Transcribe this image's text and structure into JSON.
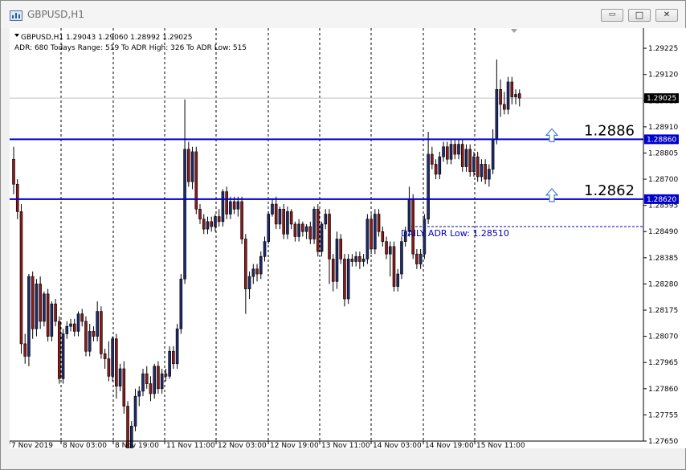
{
  "window": {
    "title": "GBPUSD,H1",
    "buttons": {
      "minimize": "▭",
      "restore": "□",
      "close": "✕"
    }
  },
  "header": {
    "symbol_line": "GBPUSD,H1  1.29043 1.29060 1.28992 1.29025",
    "adr_line": "ADR: 680  Todays Range: 519  To ADR High: 326  To ADR Low: 515"
  },
  "colors": {
    "background": "#ffffff",
    "bear_candle": "#8b1a1a",
    "bull_candle": "#1f2a6b",
    "level_line": "#0000cc",
    "level_tag": "#0000cc",
    "price_tag": "#000000",
    "arrow": "#4a7fd0",
    "grid_line": "#000000",
    "adr_line": "#0000aa",
    "current_price_line": "#c0c0c0"
  },
  "chart_data": {
    "type": "candlestick",
    "symbol": "GBPUSD",
    "timeframe": "H1",
    "y_axis": {
      "range": [
        1.2765,
        1.2928
      ],
      "ticks": [
        "1.29225",
        "1.29120",
        "1.29015",
        "1.28910",
        "1.28805",
        "1.28700",
        "1.28595",
        "1.28490",
        "1.28385",
        "1.28280",
        "1.28175",
        "1.28070",
        "1.27965",
        "1.27860",
        "1.27755",
        "1.27650"
      ]
    },
    "x_axis": {
      "labels": [
        "7 Nov 2019",
        "8 Nov 03:00",
        "8 Nov 19:00",
        "11 Nov 11:00",
        "12 Nov 03:00",
        "12 Nov 19:00",
        "13 Nov 11:00",
        "14 Nov 03:00",
        "14 Nov 19:00",
        "15 Nov 11:00"
      ]
    },
    "current_price": {
      "value": 1.29025,
      "label": "1.29025"
    },
    "levels": [
      {
        "name": "1.2886",
        "value": 1.2886,
        "axis_label": "1.28860",
        "big_label": "1.2886"
      },
      {
        "name": "1.2862",
        "value": 1.2862,
        "axis_label": "1.28620",
        "big_label": "1.2862"
      }
    ],
    "adr_low": {
      "value": 1.2851,
      "label": "DAILY ADR Low: 1.28510"
    },
    "candles": [
      [
        1.2878,
        1.2868,
        1.2883,
        1.2864
      ],
      [
        1.2868,
        1.2857,
        1.287,
        1.2854
      ],
      [
        1.2857,
        1.2804,
        1.286,
        1.28
      ],
      [
        1.2804,
        1.2799,
        1.2808,
        1.2796
      ],
      [
        1.2799,
        1.2831,
        1.2832,
        1.2795
      ],
      [
        1.2831,
        1.281,
        1.2833,
        1.2806
      ],
      [
        1.281,
        1.2828,
        1.283,
        1.2807
      ],
      [
        1.2828,
        1.2813,
        1.2831,
        1.281
      ],
      [
        1.2813,
        1.2824,
        1.2825,
        1.2811
      ],
      [
        1.2824,
        1.2807,
        1.2826,
        1.2805
      ],
      [
        1.2807,
        1.282,
        1.2821,
        1.2805
      ],
      [
        1.282,
        1.2813,
        1.2822,
        1.2811
      ],
      [
        1.2813,
        1.279,
        1.2815,
        1.2788
      ],
      [
        1.279,
        1.2808,
        1.281,
        1.2788
      ],
      [
        1.2808,
        1.2811,
        1.2813,
        1.2806
      ],
      [
        1.2811,
        1.2812,
        1.2814,
        1.2809
      ],
      [
        1.2812,
        1.2809,
        1.2814,
        1.2807
      ],
      [
        1.2809,
        1.2816,
        1.2817,
        1.2807
      ],
      [
        1.2816,
        1.2813,
        1.2818,
        1.2811
      ],
      [
        1.2813,
        1.2801,
        1.2815,
        1.2799
      ],
      [
        1.2801,
        1.2809,
        1.2812,
        1.2799
      ],
      [
        1.2809,
        1.2807,
        1.2811,
        1.2805
      ],
      [
        1.2807,
        1.2817,
        1.2821,
        1.2805
      ],
      [
        1.2817,
        1.28,
        1.2819,
        1.2798
      ],
      [
        1.28,
        1.2798,
        1.2802,
        1.2794
      ],
      [
        1.2798,
        1.2791,
        1.2805,
        1.2789
      ],
      [
        1.2791,
        1.2806,
        1.2807,
        1.2789
      ],
      [
        1.2806,
        1.2787,
        1.2808,
        1.2782
      ],
      [
        1.2787,
        1.2794,
        1.2796,
        1.2785
      ],
      [
        1.2794,
        1.2779,
        1.2797,
        1.2776
      ],
      [
        1.2779,
        1.2761,
        1.2781,
        1.2759
      ],
      [
        1.2761,
        1.2771,
        1.2773,
        1.2759
      ],
      [
        1.2771,
        1.2783,
        1.2786,
        1.2769
      ],
      [
        1.2783,
        1.2785,
        1.2787,
        1.2779
      ],
      [
        1.2785,
        1.2792,
        1.2794,
        1.2783
      ],
      [
        1.2792,
        1.2788,
        1.2795,
        1.2786
      ],
      [
        1.2788,
        1.2784,
        1.2791,
        1.2781
      ],
      [
        1.2784,
        1.2795,
        1.2796,
        1.2782
      ],
      [
        1.2795,
        1.2786,
        1.2797,
        1.2784
      ],
      [
        1.2786,
        1.2792,
        1.2794,
        1.2784
      ],
      [
        1.2792,
        1.2791,
        1.2794,
        1.2789
      ],
      [
        1.2791,
        1.2801,
        1.2803,
        1.279
      ],
      [
        1.2801,
        1.2796,
        1.2803,
        1.2794
      ],
      [
        1.2796,
        1.281,
        1.2812,
        1.2794
      ],
      [
        1.281,
        1.283,
        1.2832,
        1.2808
      ],
      [
        1.283,
        1.2882,
        1.2902,
        1.2828
      ],
      [
        1.2882,
        1.2869,
        1.2885,
        1.2867
      ],
      [
        1.2869,
        1.2881,
        1.2883,
        1.2866
      ],
      [
        1.2881,
        1.2858,
        1.2883,
        1.2856
      ],
      [
        1.2858,
        1.2854,
        1.286,
        1.2852
      ],
      [
        1.2854,
        1.285,
        1.2856,
        1.2848
      ],
      [
        1.285,
        1.2853,
        1.2855,
        1.2848
      ],
      [
        1.2853,
        1.2851,
        1.2855,
        1.2849
      ],
      [
        1.2851,
        1.2855,
        1.2856,
        1.2849
      ],
      [
        1.2855,
        1.2853,
        1.2858,
        1.2851
      ],
      [
        1.2853,
        1.2865,
        1.2866,
        1.2851
      ],
      [
        1.2865,
        1.2856,
        1.2867,
        1.2854
      ],
      [
        1.2856,
        1.2861,
        1.2863,
        1.2854
      ],
      [
        1.2861,
        1.2858,
        1.2863,
        1.2856
      ],
      [
        1.2858,
        1.2861,
        1.2863,
        1.2855
      ],
      [
        1.2861,
        1.2846,
        1.2863,
        1.2844
      ],
      [
        1.2846,
        1.2826,
        1.2848,
        1.2816
      ],
      [
        1.2826,
        1.2831,
        1.2833,
        1.2822
      ],
      [
        1.2831,
        1.2834,
        1.2836,
        1.2828
      ],
      [
        1.2834,
        1.2832,
        1.2836,
        1.2829
      ],
      [
        1.2832,
        1.2839,
        1.2841,
        1.283
      ],
      [
        1.2839,
        1.2845,
        1.2847,
        1.2837
      ],
      [
        1.2845,
        1.2856,
        1.2857,
        1.2844
      ],
      [
        1.2856,
        1.286,
        1.2862,
        1.2855
      ],
      [
        1.286,
        1.2852,
        1.2863,
        1.285
      ],
      [
        1.2852,
        1.2858,
        1.2859,
        1.285
      ],
      [
        1.2858,
        1.2848,
        1.286,
        1.2846
      ],
      [
        1.2848,
        1.2857,
        1.2859,
        1.2846
      ],
      [
        1.2857,
        1.2852,
        1.2858,
        1.285
      ],
      [
        1.2852,
        1.2847,
        1.2853,
        1.2845
      ],
      [
        1.2847,
        1.2852,
        1.2854,
        1.2845
      ],
      [
        1.2852,
        1.2849,
        1.2853,
        1.2847
      ],
      [
        1.2849,
        1.2851,
        1.2852,
        1.2846
      ],
      [
        1.2851,
        1.2846,
        1.2853,
        1.2844
      ],
      [
        1.2846,
        1.2858,
        1.2859,
        1.2844
      ],
      [
        1.2858,
        1.2841,
        1.286,
        1.2839
      ],
      [
        1.2841,
        1.2852,
        1.2853,
        1.2839
      ],
      [
        1.2852,
        1.2856,
        1.2858,
        1.285
      ],
      [
        1.2856,
        1.2838,
        1.2858,
        1.2828
      ],
      [
        1.2838,
        1.2829,
        1.284,
        1.2825
      ],
      [
        1.2829,
        1.2846,
        1.2849,
        1.2826
      ],
      [
        1.2846,
        1.2838,
        1.2848,
        1.2836
      ],
      [
        1.2838,
        1.2822,
        1.284,
        1.2819
      ],
      [
        1.2822,
        1.2838,
        1.284,
        1.282
      ],
      [
        1.2838,
        1.2837,
        1.284,
        1.2835
      ],
      [
        1.2837,
        1.2839,
        1.2841,
        1.2835
      ],
      [
        1.2839,
        1.2837,
        1.2841,
        1.2834
      ],
      [
        1.2837,
        1.2838,
        1.284,
        1.2835
      ],
      [
        1.2838,
        1.2854,
        1.2856,
        1.2836
      ],
      [
        1.2854,
        1.2842,
        1.2856,
        1.284
      ],
      [
        1.2842,
        1.2856,
        1.2858,
        1.284
      ],
      [
        1.2856,
        1.2849,
        1.2858,
        1.2847
      ],
      [
        1.2849,
        1.2845,
        1.2851,
        1.2843
      ],
      [
        1.2845,
        1.284,
        1.2847,
        1.2838
      ],
      [
        1.284,
        1.2843,
        1.2845,
        1.2831
      ],
      [
        1.2843,
        1.2827,
        1.2845,
        1.2825
      ],
      [
        1.2827,
        1.2832,
        1.2834,
        1.2825
      ],
      [
        1.2832,
        1.2845,
        1.2847,
        1.283
      ],
      [
        1.2845,
        1.2849,
        1.2851,
        1.2843
      ],
      [
        1.2849,
        1.2862,
        1.2867,
        1.2847
      ],
      [
        1.2862,
        1.284,
        1.2864,
        1.2838
      ],
      [
        1.284,
        1.2836,
        1.2842,
        1.2834
      ],
      [
        1.2836,
        1.284,
        1.2842,
        1.2834
      ],
      [
        1.284,
        1.2854,
        1.2856,
        1.2838
      ],
      [
        1.2854,
        1.288,
        1.2889,
        1.2852
      ],
      [
        1.288,
        1.2876,
        1.2883,
        1.2874
      ],
      [
        1.2876,
        1.2872,
        1.2878,
        1.287
      ],
      [
        1.2872,
        1.2879,
        1.2881,
        1.287
      ],
      [
        1.2879,
        1.2883,
        1.2885,
        1.2877
      ],
      [
        1.2883,
        1.2878,
        1.2885,
        1.2876
      ],
      [
        1.2878,
        1.2884,
        1.2886,
        1.2876
      ],
      [
        1.2884,
        1.288,
        1.2886,
        1.2878
      ],
      [
        1.288,
        1.2884,
        1.2886,
        1.2878
      ],
      [
        1.2884,
        1.2875,
        1.2886,
        1.2873
      ],
      [
        1.2875,
        1.2882,
        1.2884,
        1.2873
      ],
      [
        1.2882,
        1.2873,
        1.2884,
        1.2871
      ],
      [
        1.2873,
        1.2879,
        1.2881,
        1.2871
      ],
      [
        1.2879,
        1.2871,
        1.2881,
        1.2869
      ],
      [
        1.2871,
        1.2876,
        1.2878,
        1.2869
      ],
      [
        1.2876,
        1.287,
        1.2878,
        1.2868
      ],
      [
        1.287,
        1.2874,
        1.2876,
        1.2867
      ],
      [
        1.2874,
        1.2886,
        1.289,
        1.2872
      ],
      [
        1.2886,
        1.2906,
        1.2918,
        1.2884
      ],
      [
        1.2906,
        1.29,
        1.291,
        1.2895
      ],
      [
        1.29,
        1.2898,
        1.2905,
        1.2896
      ],
      [
        1.2898,
        1.2909,
        1.2911,
        1.2896
      ],
      [
        1.2909,
        1.2903,
        1.2911,
        1.29
      ],
      [
        1.2903,
        1.2904,
        1.2906,
        1.29
      ],
      [
        1.29043,
        1.29025,
        1.2906,
        1.28992
      ]
    ]
  }
}
